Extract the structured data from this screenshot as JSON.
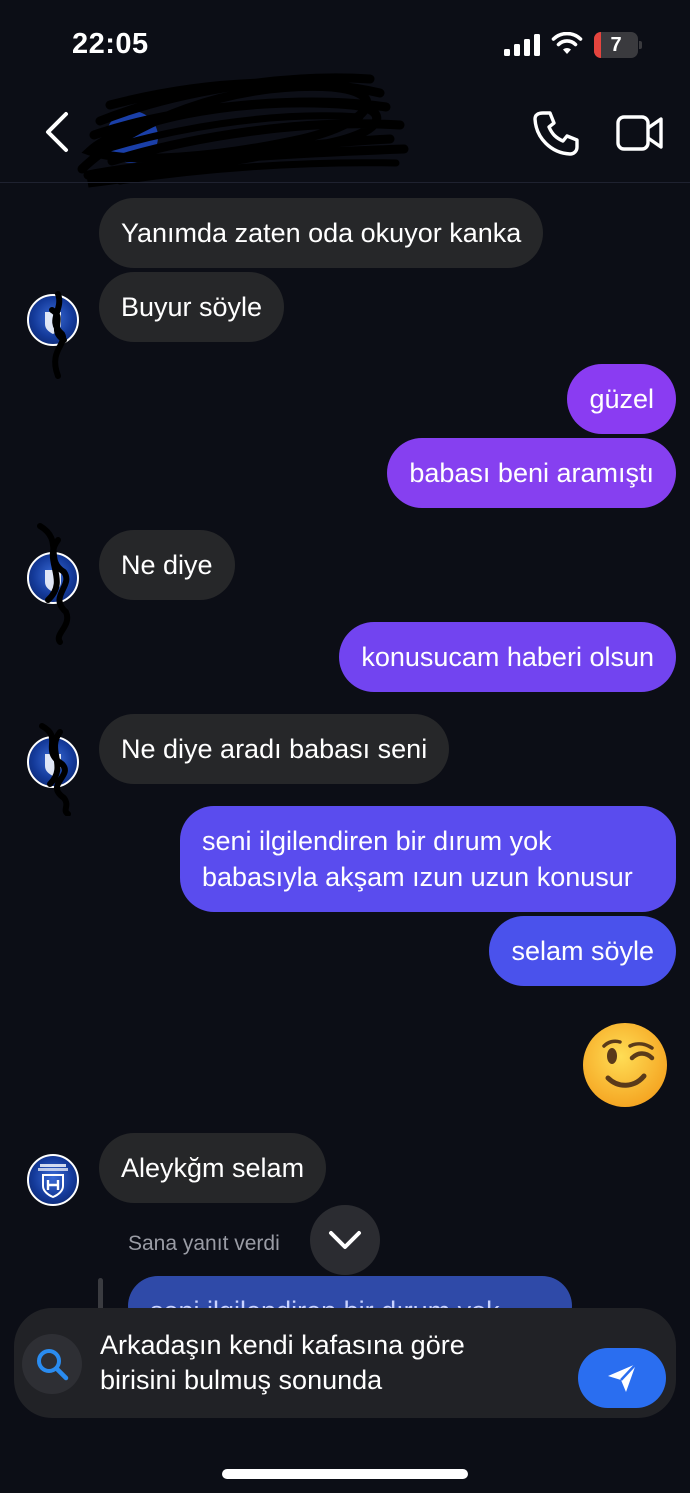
{
  "status_bar": {
    "time": "22:05",
    "battery": "7"
  },
  "header": {
    "contact_name": "",
    "icons": [
      "back-chevron-icon",
      "phone-icon",
      "video-camera-icon"
    ]
  },
  "messages": [
    {
      "side": "in",
      "text": "Yanımda zaten oda okuyor kanka"
    },
    {
      "side": "in",
      "text": "Buyur söyle"
    },
    {
      "side": "out",
      "text": "güzel"
    },
    {
      "side": "out",
      "text": "babası beni aramıştı"
    },
    {
      "side": "in",
      "text": "Ne diye"
    },
    {
      "side": "out",
      "text": "konusucam haberi olsun"
    },
    {
      "side": "in",
      "text": "Ne diye aradı babası seni"
    },
    {
      "side": "out",
      "text": "seni ilgilendiren bir dırum yok\nbabasıyla akşam ızun uzun konusur"
    },
    {
      "side": "out",
      "text": "selam söyle"
    },
    {
      "side": "out",
      "text": "😉"
    },
    {
      "side": "in",
      "text": "Aleykğm selam"
    }
  ],
  "reply": {
    "caption": "Sana yanıt verdi",
    "preview": "seni ilgilendiren bir dırum yok"
  },
  "composer": {
    "text": "Arkadaşın kendi kafasına göre\nbirisini bulmuş sonunda"
  },
  "colors": {
    "background": "#0c0e16",
    "incoming_bubble": "#262729",
    "outgoing_purple": "#8a3cf2",
    "outgoing_blue": "#4a52ec",
    "send_button": "#2a6ef0"
  }
}
